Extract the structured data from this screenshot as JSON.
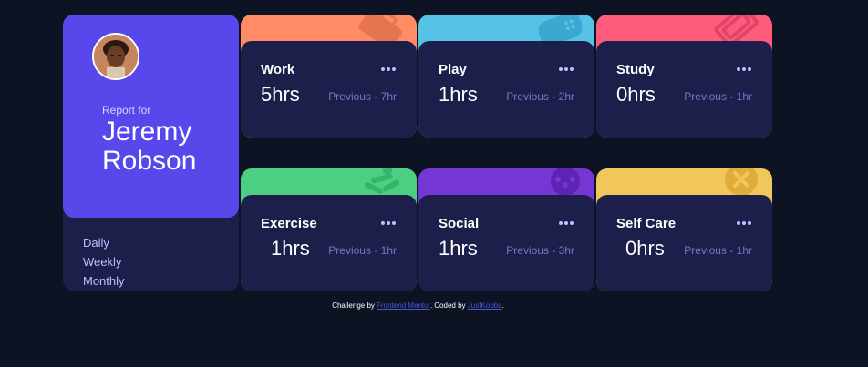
{
  "profile": {
    "report_for": "Report for",
    "name": "Jeremy Robson",
    "periods": [
      "Daily",
      "Weekly",
      "Monthly"
    ]
  },
  "cards": [
    {
      "title": "Work",
      "current": "5hrs",
      "previous": "Previous - 7hr",
      "color": "#ff8c65",
      "icon": "briefcase-icon"
    },
    {
      "title": "Play",
      "current": "1hrs",
      "previous": "Previous - 2hr",
      "color": "#56c2e6",
      "icon": "gamepad-icon"
    },
    {
      "title": "Study",
      "current": "0hrs",
      "previous": "Previous - 1hr",
      "color": "#ff5c7c",
      "icon": "book-icon"
    },
    {
      "title": "Exercise",
      "current": "1hrs",
      "previous": "Previous - 1hr",
      "color": "#4bcf83",
      "icon": "running-icon"
    },
    {
      "title": "Social",
      "current": "1hrs",
      "previous": "Previous - 3hr",
      "color": "#7536d3",
      "icon": "social-icon"
    },
    {
      "title": "Self Care",
      "current": "0hrs",
      "previous": "Previous - 1hr",
      "color": "#f1c65b",
      "icon": "self-care-icon"
    }
  ],
  "footer": {
    "prefix": "Challenge by",
    "link1": "Frontend Mentor",
    "middle": ". Coded by",
    "link2": "JustKooba",
    "suffix": "."
  },
  "colors": {
    "background": "#0d1323",
    "card": "#1c1f4a",
    "accent": "#5847eb",
    "muted": "#bdc1ff"
  }
}
